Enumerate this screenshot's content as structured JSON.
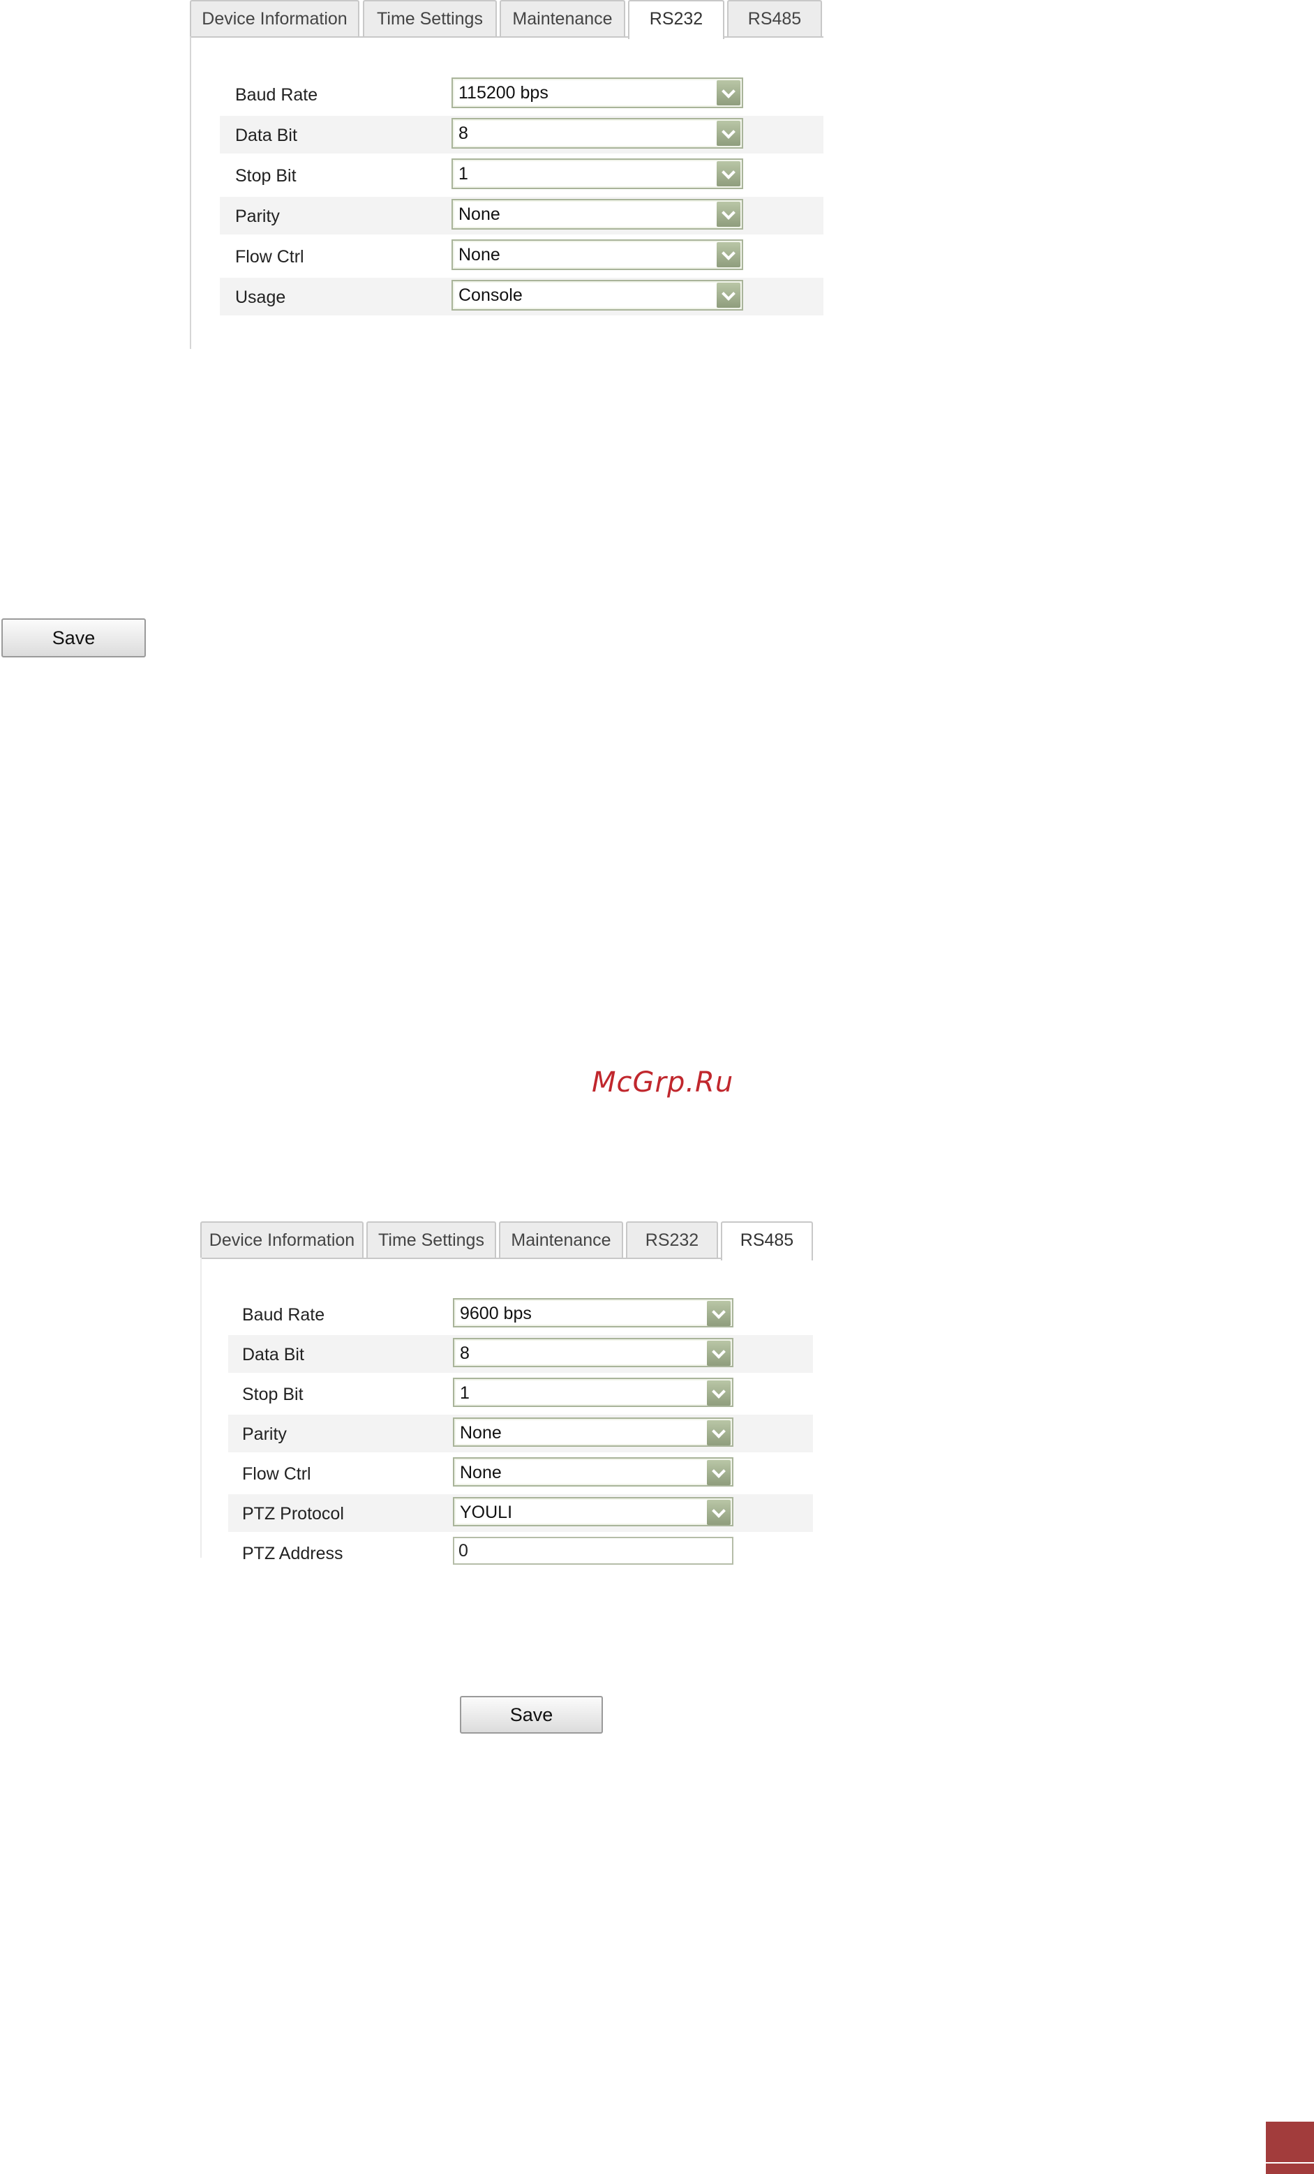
{
  "top_panel": {
    "tabs": [
      {
        "label": "Device Information",
        "active": false
      },
      {
        "label": "Time Settings",
        "active": false
      },
      {
        "label": "Maintenance",
        "active": false
      },
      {
        "label": "RS232",
        "active": true
      },
      {
        "label": "RS485",
        "active": false
      }
    ],
    "rows": [
      {
        "label": "Baud Rate",
        "value": "115200 bps"
      },
      {
        "label": "Data Bit",
        "value": "8"
      },
      {
        "label": "Stop Bit",
        "value": "1"
      },
      {
        "label": "Parity",
        "value": "None"
      },
      {
        "label": "Flow Ctrl",
        "value": "None"
      },
      {
        "label": "Usage",
        "value": "Console"
      }
    ],
    "save_label": "Save"
  },
  "watermark": "McGrp.Ru",
  "bottom_panel": {
    "tabs": [
      {
        "label": "Device Information",
        "active": false
      },
      {
        "label": "Time Settings",
        "active": false
      },
      {
        "label": "Maintenance",
        "active": false
      },
      {
        "label": "RS232",
        "active": false
      },
      {
        "label": "RS485",
        "active": true
      }
    ],
    "rows": [
      {
        "label": "Baud Rate",
        "value": "9600 bps"
      },
      {
        "label": "Data Bit",
        "value": "8"
      },
      {
        "label": "Stop Bit",
        "value": "1"
      },
      {
        "label": "Parity",
        "value": "None"
      },
      {
        "label": "Flow Ctrl",
        "value": "None"
      },
      {
        "label": "PTZ Protocol",
        "value": "YOULI"
      }
    ],
    "address_label": "PTZ Address",
    "address_value": "0",
    "save_label": "Save"
  }
}
